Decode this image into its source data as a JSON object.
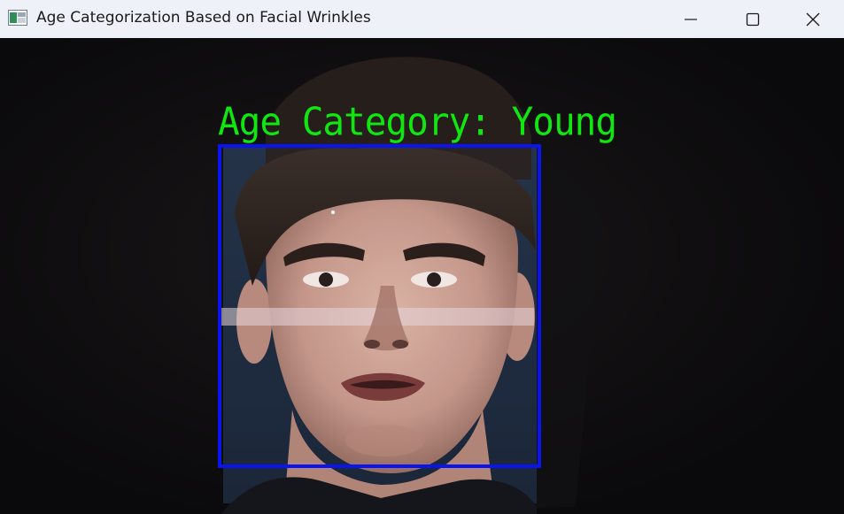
{
  "window": {
    "title": "Age Categorization Based on Facial Wrinkles",
    "icon": "app-window-icon",
    "controls": {
      "minimize": "minimize-icon",
      "maximize": "maximize-icon",
      "close": "close-icon"
    }
  },
  "overlay": {
    "label": "Age Category: Young",
    "label_color": "#11e611",
    "box_color": "#0a14f0"
  },
  "colors": {
    "titlebar_bg": "#eef2f8",
    "frame_bg": "#0b0a0c"
  }
}
